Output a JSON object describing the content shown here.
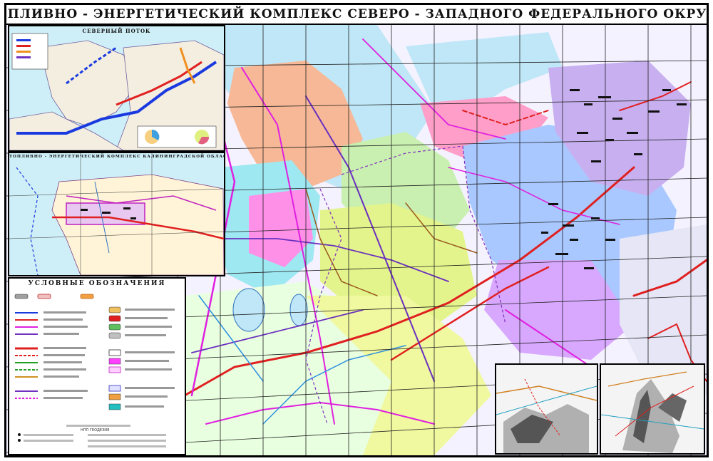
{
  "map": {
    "title": "ТОПЛИВНО - ЭНЕРГЕТИЧЕСКИЙ КОМПЛЕКС СЕВЕРО - ЗАПАДНОГО ФЕДЕРАЛЬНОГО ОКРУГА"
  },
  "insets": {
    "top_left_title": "СЕВЕРНЫЙ ПОТОК",
    "middle_left_title": "ТОПЛИВНО - ЭНЕРГЕТИЧЕСКИЙ КОМПЛЕКС КАЛИНИНГРАДСКОЙ ОБЛАСТИ",
    "legend_title": "УСЛОВНЫЕ ОБОЗНАЧЕНИЯ",
    "legend_footer": "НПП ГЕОДЕЗИЯ"
  },
  "colors": {
    "land_base": "#f4f0ff",
    "green_zone": "#c9f0b0",
    "lime_zone": "#e4f48c",
    "blue_zone": "#a8c8ff",
    "violet_zone": "#d8a8ff",
    "cyan_zone": "#9ee8f2",
    "salmon_zone": "#f6b896",
    "pink_zone": "#ff9ec8",
    "water": "#bfe7f7",
    "magenta_line": "#e020e0",
    "purple_line": "#6a2fbf",
    "red_line": "#e02020",
    "brown_line": "#9a5a20",
    "grid": "#202020"
  }
}
